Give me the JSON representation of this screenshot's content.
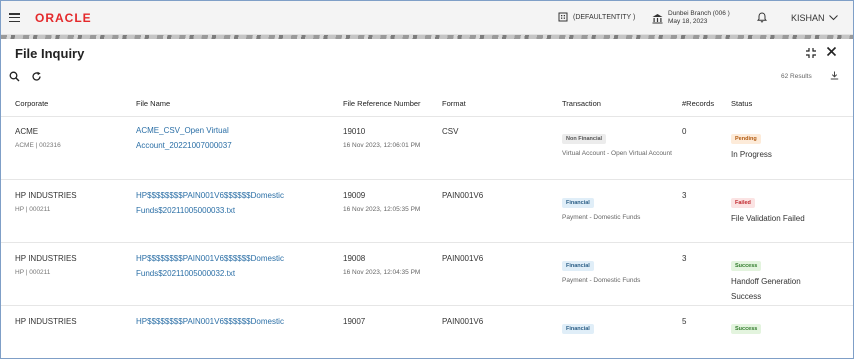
{
  "header": {
    "logo": "ORACLE",
    "entity": "(DEFAULTENTITY )",
    "branch_line1": "Dunbei Branch (006 )",
    "branch_line2": "May 18, 2023",
    "user": "KISHAN"
  },
  "panel": {
    "title": "File Inquiry",
    "results": "62 Results"
  },
  "table": {
    "columns": [
      "Corporate",
      "File Name",
      "File Reference Number",
      "Format",
      "Transaction",
      "#Records",
      "Status"
    ],
    "rows": [
      {
        "corporate": "ACME",
        "corporate_sub": "ACME | 002316",
        "file_name": "ACME_CSV_Open Virtual Account_20221007000037",
        "ref": "19010",
        "ref_date": "16 Nov 2023, 12:06:01 PM",
        "format": "CSV",
        "txn_badge": "Non Financial",
        "txn_sub": "Virtual Account - Open Virtual Account",
        "records": "0",
        "status_badge": "Pending",
        "status_text": "In Progress"
      },
      {
        "corporate": "HP INDUSTRIES",
        "corporate_sub": "HP | 000211",
        "file_name": "HP$$$$$$$$PAIN001V6$$$$$$Domestic Funds$20211005000033.txt",
        "ref": "19009",
        "ref_date": "16 Nov 2023, 12:05:35 PM",
        "format": "PAIN001V6",
        "txn_badge": "Financial",
        "txn_sub": "Payment - Domestic Funds",
        "records": "3",
        "status_badge": "Failed",
        "status_text": "File Validation Failed"
      },
      {
        "corporate": "HP INDUSTRIES",
        "corporate_sub": "HP | 000211",
        "file_name": "HP$$$$$$$$PAIN001V6$$$$$$Domestic Funds$20211005000032.txt",
        "ref": "19008",
        "ref_date": "16 Nov 2023, 12:04:35 PM",
        "format": "PAIN001V6",
        "txn_badge": "Financial",
        "txn_sub": "Payment - Domestic Funds",
        "records": "3",
        "status_badge": "Success",
        "status_text": "Handoff Generation Success"
      },
      {
        "corporate": "HP INDUSTRIES",
        "corporate_sub": "",
        "file_name": "HP$$$$$$$$PAIN001V6$$$$$$Domestic",
        "ref": "19007",
        "ref_date": "",
        "format": "PAIN001V6",
        "txn_badge": "Financial",
        "txn_sub": "",
        "records": "5",
        "status_badge": "Success",
        "status_text": ""
      }
    ]
  },
  "colors": {
    "brand": "#e4292b",
    "link": "#2b6fa6"
  }
}
